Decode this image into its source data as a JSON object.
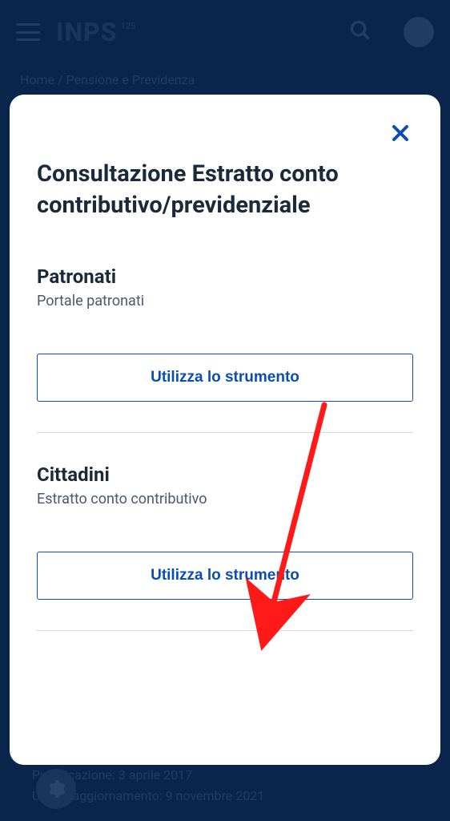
{
  "header": {
    "logo": "INPS",
    "logo_badge": "125"
  },
  "breadcrumb": "Home / Pensione e Previdenza",
  "footer": {
    "line1": "Pubblicazione: 3 aprile 2017",
    "line2": "Ultimo aggiornamento: 9 novembre 2021"
  },
  "modal": {
    "title": "Consultazione Estratto conto contributivo/previdenziale",
    "sections": [
      {
        "title": "Patronati",
        "subtitle": "Portale patronati",
        "button_label": "Utilizza lo strumento"
      },
      {
        "title": "Cittadini",
        "subtitle": "Estratto conto contributivo",
        "button_label": "Utilizza lo strumento"
      }
    ]
  }
}
